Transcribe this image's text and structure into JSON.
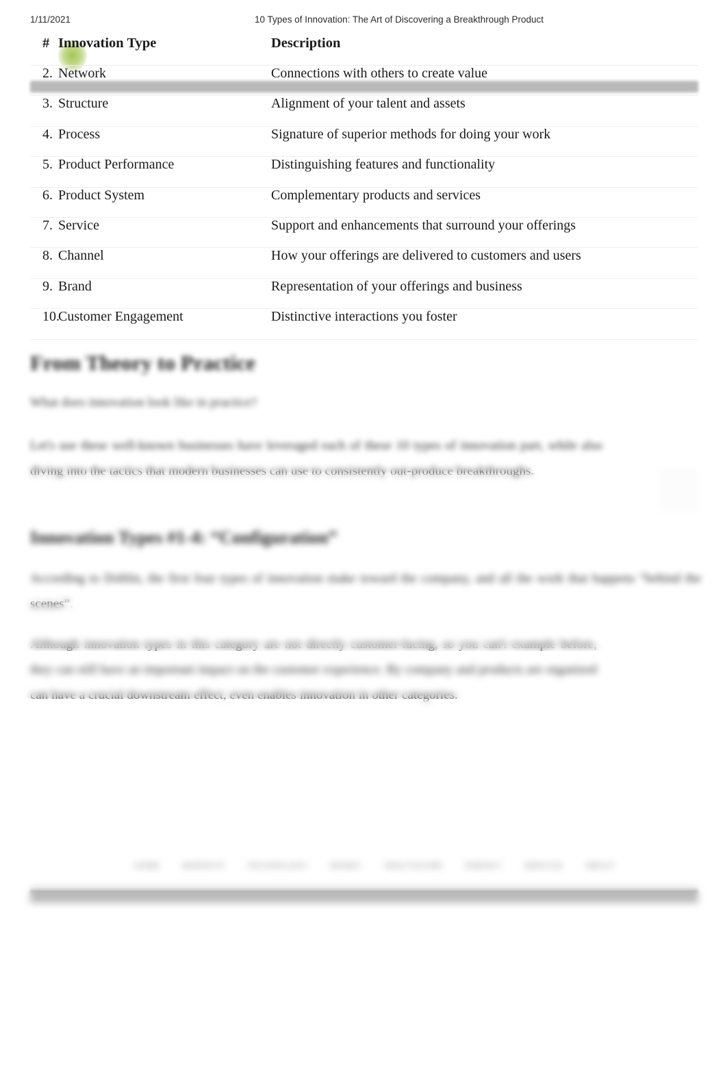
{
  "print_header": {
    "date": "1/11/2021",
    "title": "10 Types of Innovation: The Art of Discovering a Breakthrough Product"
  },
  "table": {
    "columns": [
      "#",
      "Innovation Type",
      "Description"
    ],
    "highlight_color": "#a3c34d",
    "band_color": "#b9b9b9",
    "rows": [
      {
        "num": "2.",
        "type": "Network",
        "desc": "Connections with others to create value"
      },
      {
        "num": "3.",
        "type": "Structure",
        "desc": "Alignment of your talent and assets"
      },
      {
        "num": "4.",
        "type": "Process",
        "desc": "Signature of superior methods for doing your work"
      },
      {
        "num": "5.",
        "type": "Product Performance",
        "desc": "Distinguishing features and functionality"
      },
      {
        "num": "6.",
        "type": "Product System",
        "desc": "Complementary products and services"
      },
      {
        "num": "7.",
        "type": "Service",
        "desc": "Support and enhancements that surround your offerings"
      },
      {
        "num": "8.",
        "type": "Channel",
        "desc": "How your offerings are delivered to customers and users"
      },
      {
        "num": "9.",
        "type": "Brand",
        "desc": "Representation of your offerings and business"
      },
      {
        "num": "10.",
        "type": "Customer Engagement",
        "desc": "Distinctive interactions you foster"
      }
    ]
  },
  "article": {
    "heading_theory": "From Theory to Practice",
    "subline": "What does innovation look like in practice?",
    "para_1": "Let's use these well-known businesses have leveraged each of these 10 types of innovation part, while also diving into the tactics that modern businesses can use to consistently out-produce breakthroughs.",
    "heading_types": "Innovation Types #1-4: “Configuration”",
    "para_2": "According to Doblin, the first four types of innovation make toward the company, and all the work that happens “behind the scenes”.",
    "para_3": "Although innovation types in this category are not directly customer-facing, so you can't example before, they can still have an important impact on the customer experience. By company and products are organized can have a crucial downstream effect, even enables innovation in other categories."
  },
  "site_nav": {
    "items": [
      "HOME",
      "MARKETS",
      "TECHNOLOGY",
      "MONEY",
      "HEALTHCARE",
      "ENERGY",
      "SERVICE",
      "ABOUT"
    ]
  }
}
